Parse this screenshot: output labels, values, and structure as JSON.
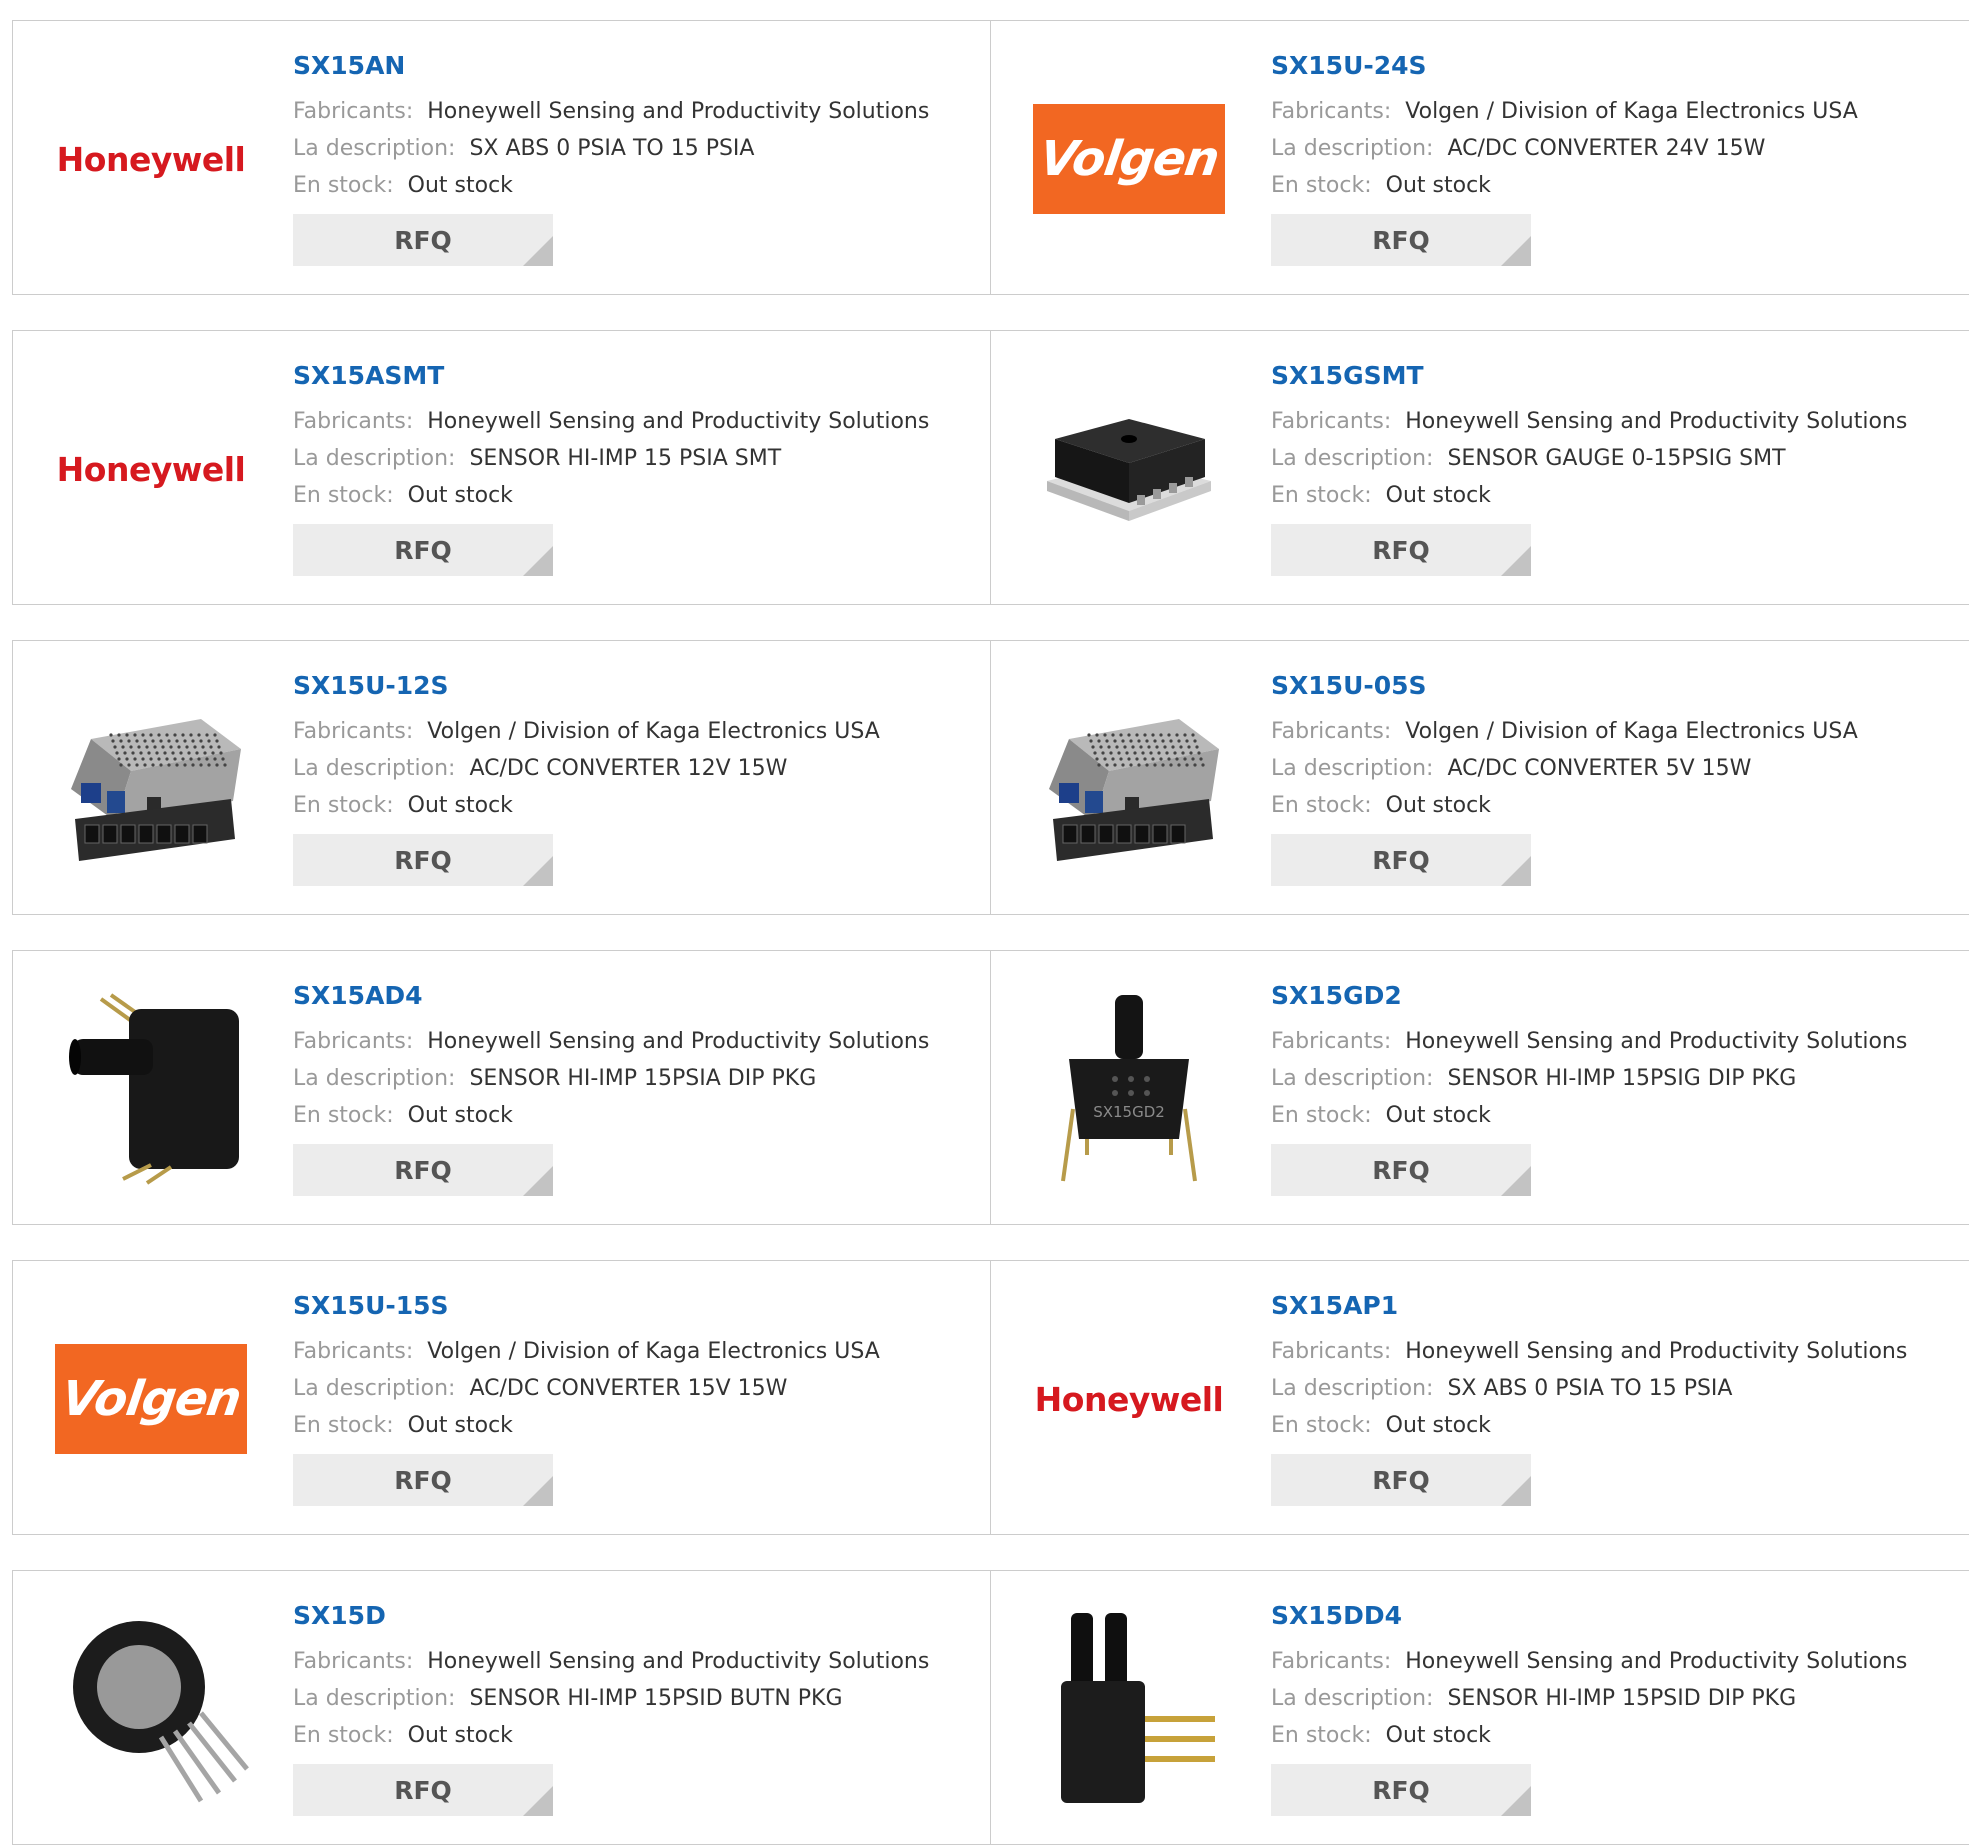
{
  "labels": {
    "manufacturer": "Fabricants:",
    "description": "La description:",
    "stock": "En stock:",
    "rfq": "RFQ"
  },
  "brands": {
    "honeywell": {
      "text": "Honeywell",
      "color": "#d6191f"
    },
    "volgen": {
      "text": "Volgen",
      "bg": "#f26722",
      "text_color": "#ffffff"
    }
  },
  "accent_color": "#1565b2",
  "products": [
    {
      "part": "SX15AN",
      "manufacturer": "Honeywell Sensing and Productivity Solutions",
      "description": "SX ABS 0 PSIA TO 15 PSIA",
      "stock": "Out stock",
      "image": "honeywell-logo"
    },
    {
      "part": "SX15U-24S",
      "manufacturer": "Volgen / Division of Kaga Electronics USA",
      "description": "AC/DC CONVERTER 24V 15W",
      "stock": "Out stock",
      "image": "volgen-logo"
    },
    {
      "part": "SX15ASMT",
      "manufacturer": "Honeywell Sensing and Productivity Solutions",
      "description": "SENSOR HI-IMP 15 PSIA SMT",
      "stock": "Out stock",
      "image": "honeywell-logo"
    },
    {
      "part": "SX15GSMT",
      "manufacturer": "Honeywell Sensing and Productivity Solutions",
      "description": "SENSOR GAUGE 0-15PSIG SMT",
      "stock": "Out stock",
      "image": "smt-sensor-image"
    },
    {
      "part": "SX15U-12S",
      "manufacturer": "Volgen / Division of Kaga Electronics USA",
      "description": "AC/DC CONVERTER 12V 15W",
      "stock": "Out stock",
      "image": "power-supply-image"
    },
    {
      "part": "SX15U-05S",
      "manufacturer": "Volgen / Division of Kaga Electronics USA",
      "description": "AC/DC CONVERTER 5V 15W",
      "stock": "Out stock",
      "image": "power-supply-image"
    },
    {
      "part": "SX15AD4",
      "manufacturer": "Honeywell Sensing and Productivity Solutions",
      "description": "SENSOR HI-IMP 15PSIA DIP PKG",
      "stock": "Out stock",
      "image": "dip-sensor-side-image"
    },
    {
      "part": "SX15GD2",
      "manufacturer": "Honeywell Sensing and Productivity Solutions",
      "description": "SENSOR HI-IMP 15PSIG DIP PKG",
      "stock": "Out stock",
      "image": "dip-sensor-front-image",
      "image_print": "SX15GD2"
    },
    {
      "part": "SX15U-15S",
      "manufacturer": "Volgen / Division of Kaga Electronics USA",
      "description": "AC/DC CONVERTER 15V 15W",
      "stock": "Out stock",
      "image": "volgen-logo"
    },
    {
      "part": "SX15AP1",
      "manufacturer": "Honeywell Sensing and Productivity Solutions",
      "description": "SX ABS 0 PSIA TO 15 PSIA",
      "stock": "Out stock",
      "image": "honeywell-logo"
    },
    {
      "part": "SX15D",
      "manufacturer": "Honeywell Sensing and Productivity Solutions",
      "description": "SENSOR HI-IMP 15PSID BUTN PKG",
      "stock": "Out stock",
      "image": "button-sensor-image"
    },
    {
      "part": "SX15DD4",
      "manufacturer": "Honeywell Sensing and Productivity Solutions",
      "description": "SENSOR HI-IMP 15PSID DIP PKG",
      "stock": "Out stock",
      "image": "dual-port-sensor-image"
    }
  ]
}
